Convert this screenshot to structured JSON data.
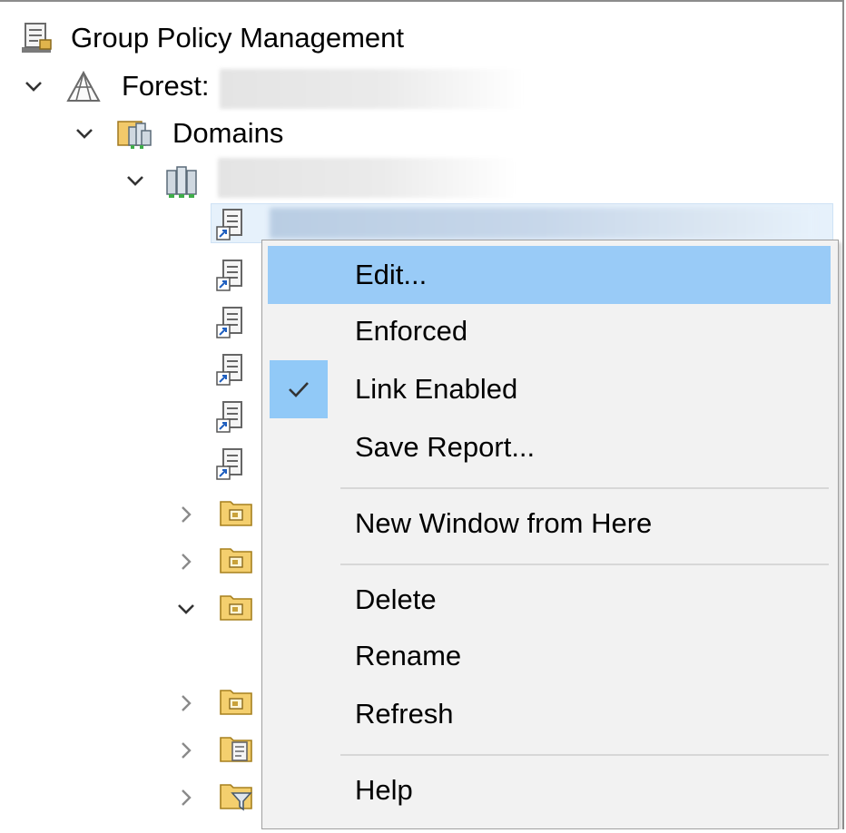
{
  "tree": {
    "root": {
      "label": "Group Policy Management",
      "icon": "gpm-console-icon"
    },
    "forest": {
      "label": "Forest:",
      "icon": "forest-icon"
    },
    "domains": {
      "label": "Domains",
      "icon": "domains-icon"
    },
    "domain": {
      "icon": "domain-icon"
    },
    "gpo_links": [
      "gpo-link-icon",
      "gpo-link-icon",
      "gpo-link-icon",
      "gpo-link-icon",
      "gpo-link-icon",
      "gpo-link-icon"
    ],
    "ous": [
      {
        "expander": "collapsed",
        "icon": "ou-icon"
      },
      {
        "expander": "collapsed",
        "icon": "ou-icon"
      },
      {
        "expander": "expanded",
        "icon": "ou-icon"
      },
      {
        "expander": "collapsed",
        "icon": "ou-icon"
      },
      {
        "expander": "collapsed",
        "icon": "gpo-container-icon"
      },
      {
        "expander": "collapsed",
        "icon": "wmi-filter-container-icon"
      }
    ]
  },
  "context_menu": {
    "items": [
      {
        "label": "Edit...",
        "highlighted": true
      },
      {
        "label": "Enforced"
      },
      {
        "label": "Link Enabled",
        "checked": true
      },
      {
        "label": "Save Report..."
      },
      {
        "label": "New Window from Here"
      },
      {
        "label": "Delete"
      },
      {
        "label": "Rename"
      },
      {
        "label": "Refresh"
      },
      {
        "label": "Help"
      }
    ]
  },
  "colors": {
    "menu_bg": "#f2f2f2",
    "menu_highlight": "#99cbf7",
    "selection_bg": "#e6f1fb",
    "check_bg": "#91c9f7"
  }
}
